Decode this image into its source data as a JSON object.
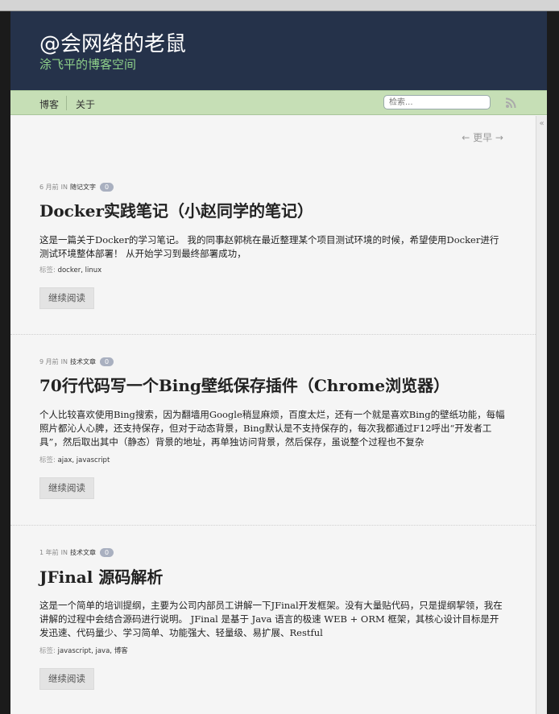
{
  "site": {
    "title": "@会网络的老鼠",
    "subtitle": "涂飞平的博客空间"
  },
  "nav": {
    "items": [
      {
        "label": "博客"
      },
      {
        "label": "关于"
      }
    ],
    "search_placeholder": "检索..."
  },
  "pager": {
    "label": "← 更早 →"
  },
  "sidebar_toggle": "«",
  "posts": [
    {
      "time": "6 月前",
      "in": "IN",
      "category": "随记文字",
      "comments": "0",
      "title": "Docker实践笔记（小赵同学的笔记）",
      "excerpt": "这是一篇关于Docker的学习笔记。 我的同事赵郭桃在最近整理某个项目测试环境的时候，希望使用Docker进行测试环境整体部署！ 从开始学习到最终部署成功，",
      "tags_label": "标签:",
      "tags": "docker, linux",
      "more": "继续阅读"
    },
    {
      "time": "9 月前",
      "in": "IN",
      "category": "技术文章",
      "comments": "0",
      "title": "70行代码写一个Bing壁纸保存插件（Chrome浏览器）",
      "excerpt": "个人比较喜欢使用Bing搜索，因为翻墙用Google稍显麻烦，百度太烂，还有一个就是喜欢Bing的壁纸功能，每幅照片都沁人心脾，还支持保存，但对于动态背景，Bing默认是不支持保存的，每次我都通过F12呼出“开发者工具”，然后取出其中（静态）背景的地址，再单独访问背景，然后保存，虽说整个过程也不复杂",
      "tags_label": "标签:",
      "tags": "ajax, javascript",
      "more": "继续阅读"
    },
    {
      "time": "1 年前",
      "in": "IN",
      "category": "技术文章",
      "comments": "0",
      "title": "JFinal 源码解析",
      "excerpt": "这是一个简单的培训提纲，主要为公司内部员工讲解一下JFinal开发框架。没有大量贴代码，只是提纲挈领，我在讲解的过程中会结合源码进行说明。 JFinal 是基于 Java 语言的极速 WEB + ORM 框架，其核心设计目标是开发迅速、代码量少、学习简单、功能强大、轻量级、易扩展、Restful",
      "tags_label": "标签:",
      "tags": "javascript, java, 博客",
      "more": "继续阅读"
    }
  ],
  "colors": {
    "header_bg": "#25324a",
    "subtitle": "#8ed08a",
    "nav_bg": "#c6dfb6",
    "badge": "#a9b0c0",
    "rss": "#aaaaaa"
  },
  "icons": {
    "rss": "rss-icon"
  }
}
